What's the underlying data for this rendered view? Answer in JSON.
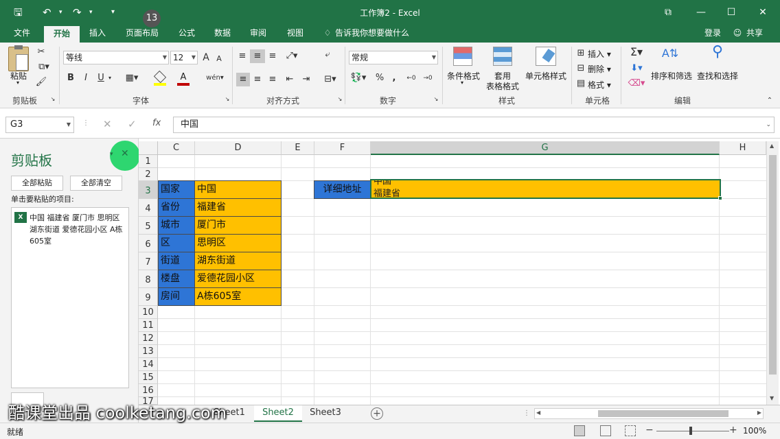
{
  "window": {
    "title": "工作簿2 - Excel",
    "buttons": [
      "⧉",
      "—",
      "☐",
      "✕"
    ]
  },
  "ribbon_tabs": [
    "文件",
    "开始",
    "插入",
    "页面布局",
    "公式",
    "数据",
    "审阅",
    "视图"
  ],
  "tell_me": "告诉我你想要做什么",
  "login": "登录",
  "share": "共享",
  "ribbon": {
    "clipboard": {
      "paste": "粘贴",
      "label": "剪贴板"
    },
    "font": {
      "name": "等线",
      "size": "12",
      "label": "字体",
      "bold": "B",
      "italic": "I",
      "underline": "U",
      "grow": "A",
      "shrink": "A"
    },
    "alignment": {
      "label": "对齐方式"
    },
    "number": {
      "format": "常规",
      "label": "数字",
      "percent": "%"
    },
    "styles": {
      "cond": "条件格式",
      "table_a": "套用",
      "table_b": "表格格式",
      "cell": "单元格样式",
      "label": "样式"
    },
    "cells": {
      "insert": "插入",
      "delete": "删除",
      "format": "格式",
      "label": "单元格"
    },
    "editing": {
      "sort": "排序和筛选",
      "find": "查找和选择",
      "label": "编辑"
    }
  },
  "formula_bar": {
    "name_box": "G3",
    "fx": "fx",
    "value": "中国"
  },
  "clipboard_pane": {
    "title": "剪贴板",
    "paste_all": "全部粘贴",
    "clear_all": "全部清空",
    "hint": "单击要粘贴的项目:",
    "item": "中国 福建省 厦门市 思明区 湖东街道 爱德花园小区 A栋605室",
    "badge": "13"
  },
  "columns": [
    "C",
    "D",
    "E",
    "F",
    "G",
    "H"
  ],
  "rows": [
    "1",
    "2",
    "3",
    "4",
    "5",
    "6",
    "7",
    "8",
    "9",
    "10",
    "11",
    "12",
    "13",
    "14",
    "15",
    "16",
    "17"
  ],
  "cells": {
    "labels": [
      "国家",
      "省份",
      "城市",
      "区",
      "街道",
      "楼盘",
      "房间"
    ],
    "values": [
      "中国",
      "福建省",
      "厦门市",
      "思明区",
      "湖东街道",
      "爱德花园小区",
      "A栋605室"
    ],
    "f3": "详细地址",
    "g3_line1": "中国",
    "g3_line2": "福建省"
  },
  "sheets": [
    "Sheet1",
    "Sheet2",
    "Sheet3"
  ],
  "status": {
    "ready": "就绪",
    "zoom": "100%"
  },
  "watermark": "酷课堂出品 coolketang.com",
  "colors": {
    "excel_green": "#217346",
    "blue_fill": "#2e75d6",
    "orange_fill": "#ffc000"
  }
}
